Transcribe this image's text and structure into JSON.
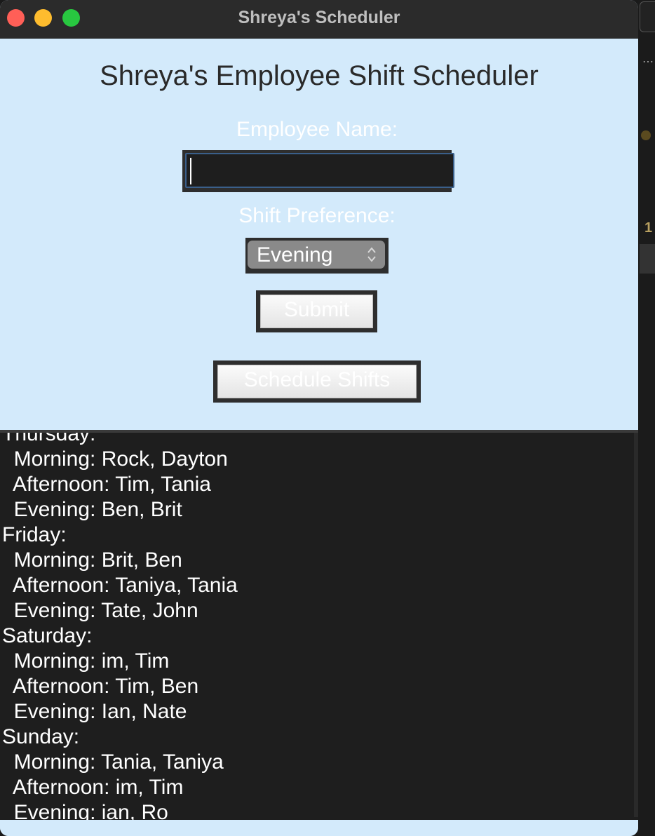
{
  "window": {
    "title": "Shreya's Scheduler"
  },
  "form": {
    "heading": "Shreya's Employee Shift Scheduler",
    "name_label": "Employee Name:",
    "name_value": "",
    "shift_label": "Shift Preference:",
    "shift_selected": "Evening",
    "submit_label": "Submit",
    "schedule_label": "Schedule Shifts"
  },
  "output": {
    "lines": [
      "Thursday:",
      "  Morning: Rock, Dayton",
      "  Afternoon: Tim, Tania",
      "  Evening: Ben, Brit",
      "Friday:",
      "  Morning: Brit, Ben",
      "  Afternoon: Taniya, Tania",
      "  Evening: Tate, John",
      "Saturday:",
      "  Morning: im, Tim",
      "  Afternoon: Tim, Ben",
      "  Evening: Ian, Nate",
      "Sunday:",
      "  Morning: Tania, Taniya",
      "  Afternoon: im, Tim",
      "  Evening: ian, Ro"
    ]
  },
  "background": {
    "line_number": "1"
  },
  "colors": {
    "window_bg": "#d3eafb",
    "titlebar_bg": "#2b2b2b",
    "output_bg": "#1e1e1e",
    "close": "#ff5f57",
    "minimize": "#febc2e",
    "maximize": "#28c840"
  }
}
